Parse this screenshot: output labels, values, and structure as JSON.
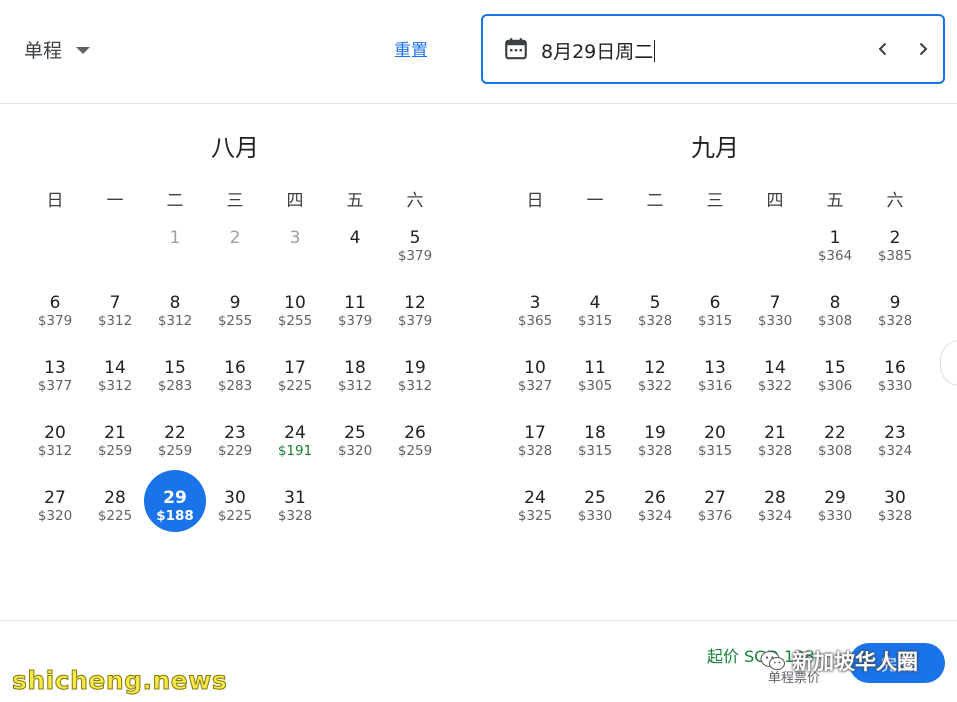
{
  "header": {
    "trip_type": "单程",
    "reset_label": "重置",
    "selected_date_text": "8月29日周二"
  },
  "weekdays": [
    "日",
    "一",
    "二",
    "三",
    "四",
    "五",
    "六"
  ],
  "months": [
    {
      "title": "八月",
      "first_weekday": 2,
      "days": [
        {
          "d": "1",
          "p": "",
          "state": "disabled"
        },
        {
          "d": "2",
          "p": "",
          "state": "disabled"
        },
        {
          "d": "3",
          "p": "",
          "state": "disabled"
        },
        {
          "d": "4",
          "p": ""
        },
        {
          "d": "5",
          "p": "$379"
        },
        {
          "d": "6",
          "p": "$379"
        },
        {
          "d": "7",
          "p": "$312"
        },
        {
          "d": "8",
          "p": "$312"
        },
        {
          "d": "9",
          "p": "$255"
        },
        {
          "d": "10",
          "p": "$255"
        },
        {
          "d": "11",
          "p": "$379"
        },
        {
          "d": "12",
          "p": "$379"
        },
        {
          "d": "13",
          "p": "$377"
        },
        {
          "d": "14",
          "p": "$312"
        },
        {
          "d": "15",
          "p": "$283"
        },
        {
          "d": "16",
          "p": "$283"
        },
        {
          "d": "17",
          "p": "$225"
        },
        {
          "d": "18",
          "p": "$312"
        },
        {
          "d": "19",
          "p": "$312"
        },
        {
          "d": "20",
          "p": "$312"
        },
        {
          "d": "21",
          "p": "$259"
        },
        {
          "d": "22",
          "p": "$259"
        },
        {
          "d": "23",
          "p": "$229"
        },
        {
          "d": "24",
          "p": "$191",
          "state": "cheap"
        },
        {
          "d": "25",
          "p": "$320"
        },
        {
          "d": "26",
          "p": "$259"
        },
        {
          "d": "27",
          "p": "$320"
        },
        {
          "d": "28",
          "p": "$225"
        },
        {
          "d": "29",
          "p": "$188",
          "state": "selected"
        },
        {
          "d": "30",
          "p": "$225"
        },
        {
          "d": "31",
          "p": "$328"
        }
      ]
    },
    {
      "title": "九月",
      "first_weekday": 5,
      "days": [
        {
          "d": "1",
          "p": "$364"
        },
        {
          "d": "2",
          "p": "$385"
        },
        {
          "d": "3",
          "p": "$365"
        },
        {
          "d": "4",
          "p": "$315"
        },
        {
          "d": "5",
          "p": "$328"
        },
        {
          "d": "6",
          "p": "$315"
        },
        {
          "d": "7",
          "p": "$330"
        },
        {
          "d": "8",
          "p": "$308"
        },
        {
          "d": "9",
          "p": "$328"
        },
        {
          "d": "10",
          "p": "$327"
        },
        {
          "d": "11",
          "p": "$305"
        },
        {
          "d": "12",
          "p": "$322"
        },
        {
          "d": "13",
          "p": "$316"
        },
        {
          "d": "14",
          "p": "$322"
        },
        {
          "d": "15",
          "p": "$306"
        },
        {
          "d": "16",
          "p": "$330"
        },
        {
          "d": "17",
          "p": "$328"
        },
        {
          "d": "18",
          "p": "$315"
        },
        {
          "d": "19",
          "p": "$328"
        },
        {
          "d": "20",
          "p": "$315"
        },
        {
          "d": "21",
          "p": "$328"
        },
        {
          "d": "22",
          "p": "$308"
        },
        {
          "d": "23",
          "p": "$324"
        },
        {
          "d": "24",
          "p": "$325"
        },
        {
          "d": "25",
          "p": "$330"
        },
        {
          "d": "26",
          "p": "$324"
        },
        {
          "d": "27",
          "p": "$376"
        },
        {
          "d": "28",
          "p": "$324"
        },
        {
          "d": "29",
          "p": "$330"
        },
        {
          "d": "30",
          "p": "$328"
        }
      ]
    }
  ],
  "footer": {
    "from_price": "起价 SGD 188",
    "from_price_sub": "单程票价",
    "done_label": "完成"
  },
  "watermarks": {
    "left": "shicheng.news",
    "right": "新加坡华人圈"
  },
  "colors": {
    "accent": "#1a73e8",
    "cheap_price": "#188038",
    "muted_text": "#5f6368"
  },
  "icons": {
    "date_field": "calendar-icon",
    "prev": "chevron-left-icon",
    "next": "chevron-right-icon",
    "trip_select": "caret-down-icon"
  }
}
